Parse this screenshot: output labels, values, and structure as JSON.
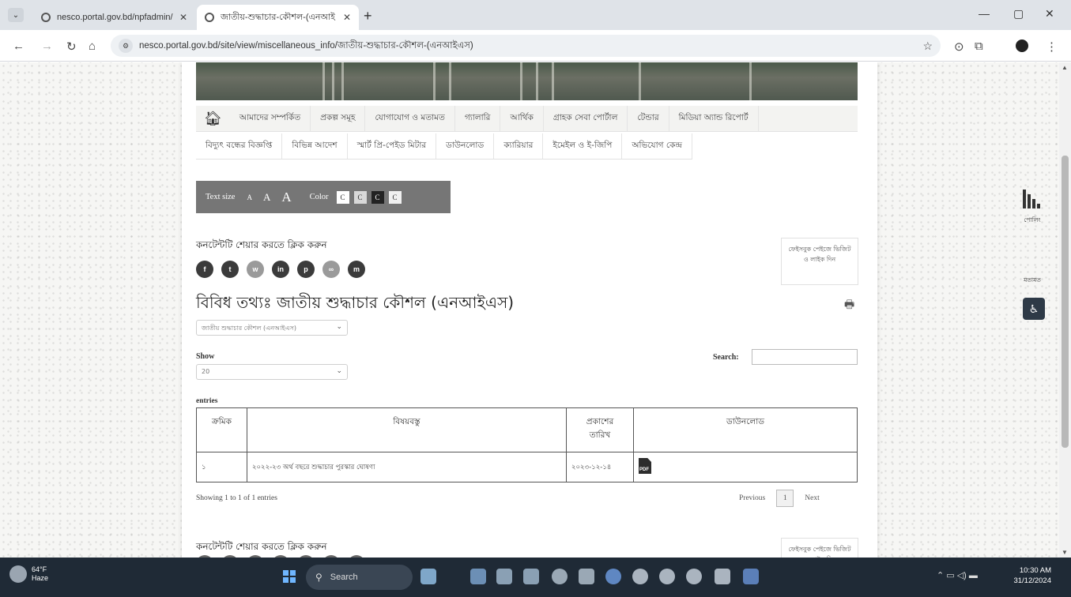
{
  "browser": {
    "tabs": [
      {
        "title": "nesco.portal.gov.bd/npfadmin/",
        "active": false
      },
      {
        "title": "জাতীয়-শুদ্ধাচার-কৌশল-(এনআই",
        "active": true
      }
    ],
    "url": "nesco.portal.gov.bd/site/view/miscellaneous_info/জাতীয়-শুদ্ধাচার-কৌশল-(এনআইএস)"
  },
  "menu": {
    "row1": [
      "আমাদের সম্পর্কিত",
      "প্রকল্প সমূহ",
      "যোগাযোগ ও মতামত",
      "গ্যালারি",
      "আর্থিক",
      "গ্রাহক সেবা পোর্টাল",
      "টেন্ডার",
      "মিডিয়া অ্যান্ড রিপোর্ট"
    ],
    "row2": [
      "বিদ্যুৎ বন্ধের বিজ্ঞপ্তি",
      "বিভিন্ন আদেশ",
      "স্মার্ট প্রি-পেইড মিটার",
      "ডাউনলোড",
      "ক্যারিয়ার",
      "ইমেইল ও ই-জিপি",
      "অভিযোগ কেন্দ্র"
    ]
  },
  "accessibility": {
    "text_size_label": "Text size",
    "sizes": [
      "A",
      "A",
      "A"
    ],
    "color_label": "Color",
    "color_options": [
      {
        "label": "C",
        "bg": "#ffffff"
      },
      {
        "label": "C",
        "bg": "#d9d9d9"
      },
      {
        "label": "C",
        "bg": "#222222"
      },
      {
        "label": "C",
        "bg": "#f0f0f0"
      }
    ]
  },
  "share": {
    "label": "কনটেন্টটি শেয়ার করতে ক্লিক করুন",
    "buttons": [
      {
        "icon": "facebook-icon",
        "glyph": "f",
        "color": "#3b3b3b"
      },
      {
        "icon": "twitter-icon",
        "glyph": "t",
        "color": "#3b3b3b"
      },
      {
        "icon": "whatsapp-icon",
        "glyph": "w",
        "color": "#9a9a9a"
      },
      {
        "icon": "linkedin-icon",
        "glyph": "in",
        "color": "#3b3b3b"
      },
      {
        "icon": "pinterest-icon",
        "glyph": "p",
        "color": "#3b3b3b"
      },
      {
        "icon": "link-icon",
        "glyph": "∞",
        "color": "#9a9a9a"
      },
      {
        "icon": "messenger-icon",
        "glyph": "m",
        "color": "#3b3b3b"
      }
    ],
    "fb_box": "ফেইসবুক পেইজে ভিজিট ও লাইক দিন"
  },
  "page": {
    "title": "বিবিধ তথ্যঃ জাতীয় শুদ্ধাচার কৌশল (এনআইএস)",
    "category_select": "জাতীয় শুদ্ধাচার কৌশল (এনআইএস)",
    "show_label": "Show",
    "show_value": "20",
    "search_label": "Search:",
    "search_value": "",
    "entries_label": "entries"
  },
  "table": {
    "headers": [
      "ক্রমিক",
      "বিষয়বস্তু",
      "প্রকাশের তারিখ",
      "ডাউনলোড"
    ],
    "rows": [
      {
        "serial": "১",
        "subject": "২০২২-২৩ অর্থ বছরে শুদ্ধাচার পুরস্কার ঘোষণা",
        "date": "২০২৩-১২-১৪",
        "download": "PDF"
      }
    ]
  },
  "pagination": {
    "summary": "Showing 1 to 1 of 1 entries",
    "previous": "Previous",
    "current": "1",
    "next": "Next"
  },
  "side_widgets": {
    "poll": "পোলিং",
    "opinion": "মতামত"
  },
  "taskbar": {
    "weather_temp": "64°F",
    "weather_desc": "Haze",
    "search": "Search",
    "time": "10:30 AM",
    "date": "31/12/2024"
  }
}
